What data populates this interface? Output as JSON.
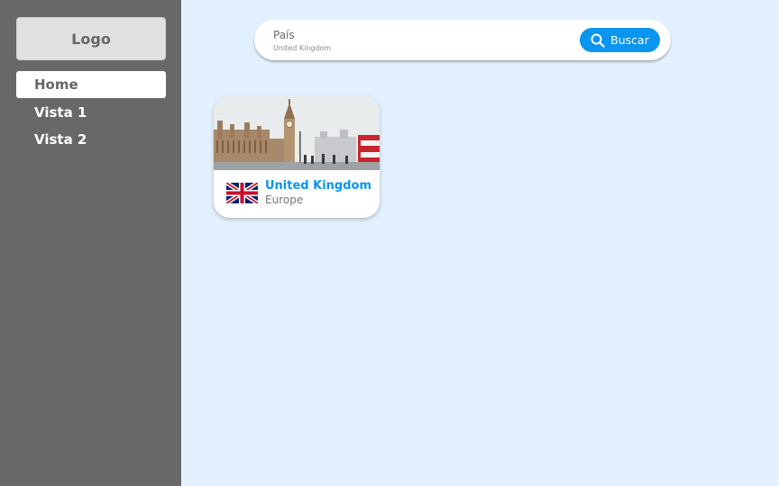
{
  "sidebar": {
    "logo": "Logo",
    "items": [
      {
        "label": "Home",
        "active": true
      },
      {
        "label": "Vista 1",
        "active": false
      },
      {
        "label": "Vista 2",
        "active": false
      }
    ],
    "background": "#686868"
  },
  "search": {
    "label": "País",
    "value": "United Kingdom",
    "button_label": "Buscar",
    "button_icon": "search-icon",
    "accent": "#0a95ef"
  },
  "results": [
    {
      "country": "United Kingdom",
      "region": "Europe",
      "flag_icon": "uk-flag-icon",
      "image": "london-landmarks-photo"
    }
  ],
  "colors": {
    "page_background": "#e2f1fd",
    "accent": "#0a95ef"
  }
}
